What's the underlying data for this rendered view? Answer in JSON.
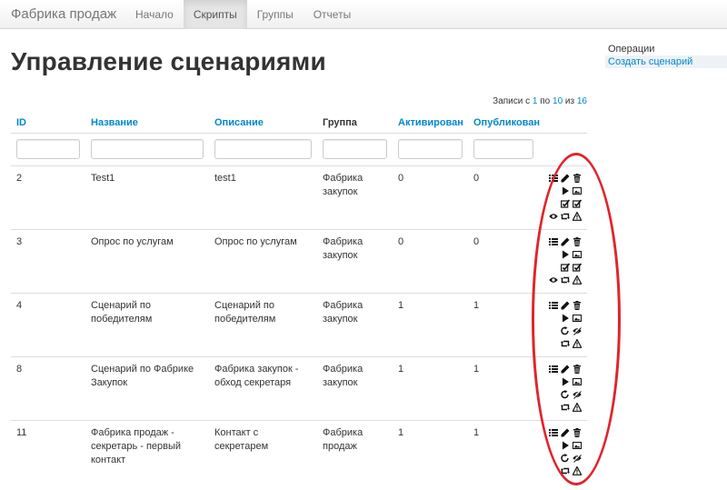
{
  "brand": "Фабрика продаж",
  "nav": [
    "Начало",
    "Скрипты",
    "Группы",
    "Отчеты"
  ],
  "page_title": "Управление сценариями",
  "operations": {
    "title": "Операции",
    "create_link": "Создать сценарий"
  },
  "summary": {
    "prefix": "Записи с",
    "from": "1",
    "sep1": "по",
    "to": "10",
    "sep2": "из",
    "total": "16"
  },
  "columns": {
    "id": "ID",
    "name": "Название",
    "description": "Описание",
    "group": "Группа",
    "activated": "Активирован",
    "published": "Опубликован"
  },
  "rows": [
    {
      "id": "2",
      "name": "Test1",
      "description": "test1",
      "group": "Фабрика закупок",
      "activated": "0",
      "published": "0"
    },
    {
      "id": "3",
      "name": "Опрос по услугам",
      "description": "Опрос по услугам",
      "group": "Фабрика закупок",
      "activated": "0",
      "published": "0"
    },
    {
      "id": "4",
      "name": "Сценарий по победителям",
      "description": "Сценарий по победителям",
      "group": "Фабрика закупок",
      "activated": "1",
      "published": "1"
    },
    {
      "id": "8",
      "name": "Сценарий по Фабрике Закупок",
      "description": "Фабрика закупок - обход секретаря",
      "group": "Фабрика закупок",
      "activated": "1",
      "published": "1"
    },
    {
      "id": "11",
      "name": "Фабрика продаж - секретарь - первый контакт",
      "description": "Контакт с секретарем",
      "group": "Фабрика продаж",
      "activated": "1",
      "published": "1"
    }
  ],
  "icons": {
    "row_unpublished": [
      [
        "list-icon",
        "pencil-icon",
        "trash-icon"
      ],
      [
        "play-icon",
        "picture-icon"
      ],
      [
        "check-icon",
        "check-icon"
      ],
      [
        "eye-icon",
        "retweet-icon",
        "warning-icon"
      ]
    ],
    "row_published": [
      [
        "list-icon",
        "pencil-icon",
        "trash-icon"
      ],
      [
        "play-icon",
        "picture-icon"
      ],
      [
        "share-icon",
        "eye-off-icon"
      ],
      [
        "retweet-icon",
        "warning-icon"
      ]
    ]
  },
  "colors": {
    "link": "#0088cc",
    "annotation": "#e0242b"
  }
}
